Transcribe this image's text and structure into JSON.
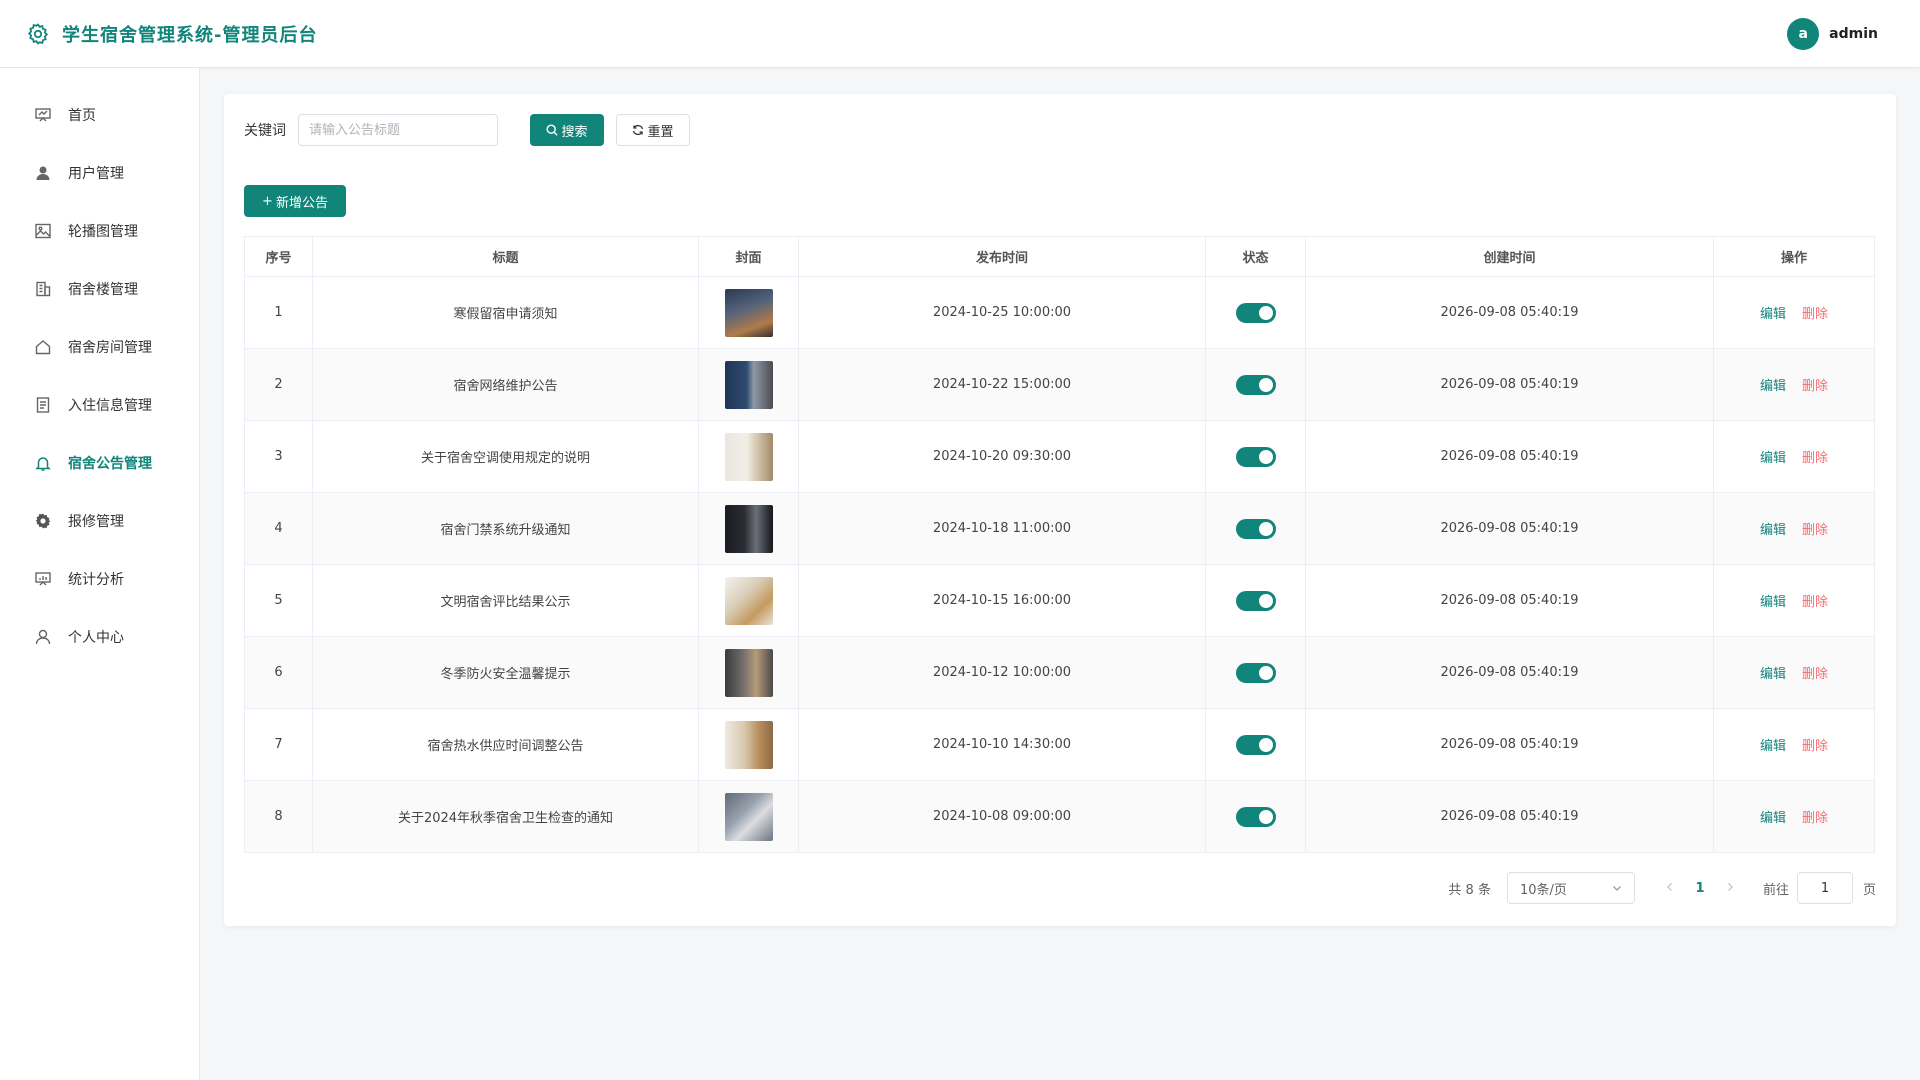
{
  "header": {
    "title": "学生宿舍管理系统-管理员后台",
    "avatar_letter": "a",
    "username": "admin",
    "accent": "#12857a"
  },
  "sidebar": {
    "items": [
      {
        "label": "首页",
        "icon": "dashboard-icon"
      },
      {
        "label": "用户管理",
        "icon": "user-icon"
      },
      {
        "label": "轮播图管理",
        "icon": "image-icon"
      },
      {
        "label": "宿舍楼管理",
        "icon": "building-icon"
      },
      {
        "label": "宿舍房间管理",
        "icon": "house-icon"
      },
      {
        "label": "入住信息管理",
        "icon": "document-icon"
      },
      {
        "label": "宿舍公告管理",
        "icon": "bell-icon",
        "active": true
      },
      {
        "label": "报修管理",
        "icon": "gear-icon"
      },
      {
        "label": "统计分析",
        "icon": "chart-board-icon"
      },
      {
        "label": "个人中心",
        "icon": "person-icon"
      }
    ]
  },
  "search": {
    "label": "关键词",
    "placeholder": "请输入公告标题",
    "value": "",
    "search_button": "搜索",
    "reset_button": "重置"
  },
  "toolbar": {
    "add_button": "新增公告"
  },
  "table": {
    "columns": [
      "序号",
      "标题",
      "封面",
      "发布时间",
      "状态",
      "创建时间",
      "操作"
    ],
    "edit_label": "编辑",
    "delete_label": "删除",
    "rows": [
      {
        "index": "1",
        "title": "寒假留宿申请须知",
        "publish_time": "2024-10-25 10:00:00",
        "status": true,
        "created": "2026-09-08 05:40:19"
      },
      {
        "index": "2",
        "title": "宿舍网络维护公告",
        "publish_time": "2024-10-22 15:00:00",
        "status": true,
        "created": "2026-09-08 05:40:19"
      },
      {
        "index": "3",
        "title": "关于宿舍空调使用规定的说明",
        "publish_time": "2024-10-20 09:30:00",
        "status": true,
        "created": "2026-09-08 05:40:19"
      },
      {
        "index": "4",
        "title": "宿舍门禁系统升级通知",
        "publish_time": "2024-10-18 11:00:00",
        "status": true,
        "created": "2026-09-08 05:40:19"
      },
      {
        "index": "5",
        "title": "文明宿舍评比结果公示",
        "publish_time": "2024-10-15 16:00:00",
        "status": true,
        "created": "2026-09-08 05:40:19"
      },
      {
        "index": "6",
        "title": "冬季防火安全温馨提示",
        "publish_time": "2024-10-12 10:00:00",
        "status": true,
        "created": "2026-09-08 05:40:19"
      },
      {
        "index": "7",
        "title": "宿舍热水供应时间调整公告",
        "publish_time": "2024-10-10 14:30:00",
        "status": true,
        "created": "2026-09-08 05:40:19"
      },
      {
        "index": "8",
        "title": "关于2024年秋季宿舍卫生检查的通知",
        "publish_time": "2024-10-08 09:00:00",
        "status": true,
        "created": "2026-09-08 05:40:19"
      }
    ]
  },
  "pagination": {
    "total_text": "共 8 条",
    "page_size": "10条/页",
    "current_page": "1",
    "goto_label": "前往",
    "goto_value": "1",
    "goto_suffix": "页"
  }
}
